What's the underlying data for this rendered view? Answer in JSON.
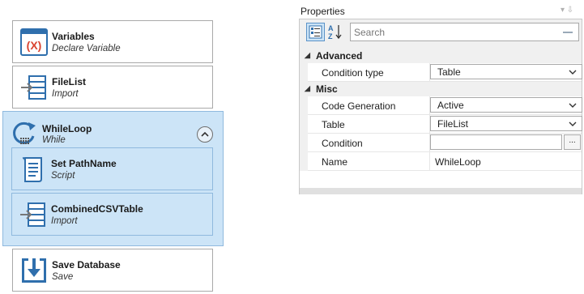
{
  "workflow": {
    "steps": [
      {
        "title": "Variables",
        "subtitle": "Declare Variable",
        "icon": "variable-icon"
      },
      {
        "title": "FileList",
        "subtitle": "Import",
        "icon": "import-icon"
      },
      {
        "title": "WhileLoop",
        "subtitle": "While",
        "icon": "loop-icon",
        "children": [
          {
            "title": "Set PathName",
            "subtitle": "Script",
            "icon": "script-icon"
          },
          {
            "title": "CombinedCSVTable",
            "subtitle": "Import",
            "icon": "import-icon"
          }
        ]
      },
      {
        "title": "Save Database",
        "subtitle": "Save",
        "icon": "save-icon"
      }
    ],
    "variable_icon_text": "(X)"
  },
  "properties": {
    "title": "Properties",
    "search_placeholder": "Search",
    "categories": [
      {
        "label": "Advanced",
        "rows": [
          {
            "name": "Condition type",
            "value": "Table",
            "editor": "dropdown"
          }
        ]
      },
      {
        "label": "Misc",
        "rows": [
          {
            "name": "Code Generation",
            "value": "Active",
            "editor": "dropdown"
          },
          {
            "name": "Table",
            "value": "FileList",
            "editor": "dropdown"
          },
          {
            "name": "Condition",
            "value": "",
            "editor": "ellipsis"
          },
          {
            "name": "Name",
            "value": "WhileLoop",
            "editor": "text"
          }
        ]
      }
    ],
    "ellipsis_label": "...",
    "sort_glyph_a": "A",
    "sort_glyph_z": "Z",
    "panel_controls": "▾ ⇩"
  },
  "colors": {
    "selection": "#cce4f7",
    "accent_blue": "#2f6fad"
  }
}
